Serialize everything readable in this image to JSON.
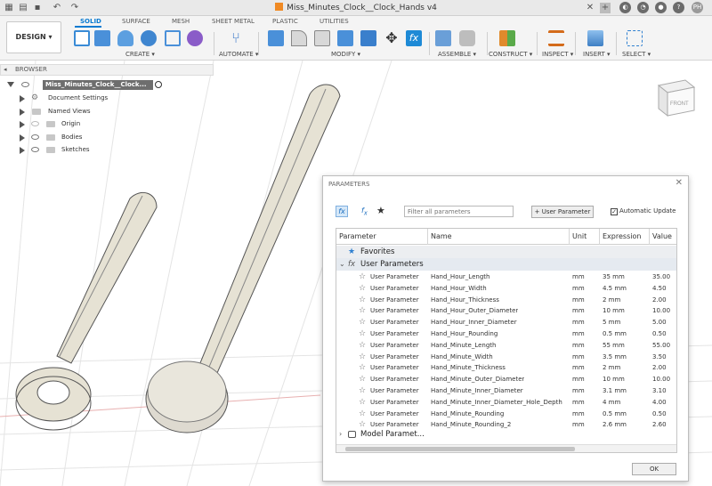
{
  "window": {
    "doc_title": "Miss_Minutes_Clock__Clock_Hands v4",
    "avatar": "PH"
  },
  "toolbar": {
    "design": "DESIGN ▾",
    "tabs": [
      "SOLID",
      "SURFACE",
      "MESH",
      "SHEET METAL",
      "PLASTIC",
      "UTILITIES"
    ],
    "groups": [
      "CREATE ▾",
      "AUTOMATE ▾",
      "MODIFY ▾",
      "ASSEMBLE ▾",
      "CONSTRUCT ▾",
      "INSPECT ▾",
      "INSERT ▾",
      "SELECT ▾"
    ]
  },
  "browser": {
    "header": "BROWSER",
    "items": [
      "Miss_Minutes_Clock__Clock...",
      "Document Settings",
      "Named Views",
      "Origin",
      "Bodies",
      "Sketches"
    ]
  },
  "viewcube": {
    "face": "FRONT"
  },
  "dialog": {
    "title": "PARAMETERS",
    "filter_placeholder": "Filter all parameters",
    "user_param_button": "+ User Parameter",
    "auto_update": "Automatic Update",
    "auto_update_checked": true,
    "columns": [
      "Parameter",
      "Name",
      "Unit",
      "Expression",
      "Value"
    ],
    "favorites": "Favorites",
    "user_params": "User Parameters",
    "model_params": "Model Paramet...",
    "ok": "OK",
    "rows": [
      {
        "param": "User Parameter",
        "name": "Hand_Hour_Length",
        "unit": "mm",
        "expr": "35 mm",
        "value": "35.00"
      },
      {
        "param": "User Parameter",
        "name": "Hand_Hour_Width",
        "unit": "mm",
        "expr": "4.5 mm",
        "value": "4.50"
      },
      {
        "param": "User Parameter",
        "name": "Hand_Hour_Thickness",
        "unit": "mm",
        "expr": "2 mm",
        "value": "2.00"
      },
      {
        "param": "User Parameter",
        "name": "Hand_Hour_Outer_Diameter",
        "unit": "mm",
        "expr": "10 mm",
        "value": "10.00"
      },
      {
        "param": "User Parameter",
        "name": "Hand_Hour_Inner_Diameter",
        "unit": "mm",
        "expr": "5 mm",
        "value": "5.00"
      },
      {
        "param": "User Parameter",
        "name": "Hand_Hour_Rounding",
        "unit": "mm",
        "expr": "0.5 mm",
        "value": "0.50"
      },
      {
        "param": "User Parameter",
        "name": "Hand_Minute_Length",
        "unit": "mm",
        "expr": "55 mm",
        "value": "55.00"
      },
      {
        "param": "User Parameter",
        "name": "Hand_Minute_Width",
        "unit": "mm",
        "expr": "3.5 mm",
        "value": "3.50"
      },
      {
        "param": "User Parameter",
        "name": "Hand_Minute_Thickness",
        "unit": "mm",
        "expr": "2 mm",
        "value": "2.00"
      },
      {
        "param": "User Parameter",
        "name": "Hand_Minute_Outer_Diameter",
        "unit": "mm",
        "expr": "10 mm",
        "value": "10.00"
      },
      {
        "param": "User Parameter",
        "name": "Hand_Minute_Inner_Diameter",
        "unit": "mm",
        "expr": "3.1 mm",
        "value": "3.10"
      },
      {
        "param": "User Parameter",
        "name": "Hand_Minute_Inner_Diameter_Hole_Depth",
        "unit": "mm",
        "expr": "4 mm",
        "value": "4.00"
      },
      {
        "param": "User Parameter",
        "name": "Hand_Minute_Rounding",
        "unit": "mm",
        "expr": "0.5 mm",
        "value": "0.50"
      },
      {
        "param": "User Parameter",
        "name": "Hand_Minute_Rounding_2",
        "unit": "mm",
        "expr": "2.6 mm",
        "value": "2.60"
      }
    ]
  },
  "colors": {
    "accent": "#0a7bd1",
    "model": "#e6e2d4",
    "model_edge": "#555555",
    "grid": "#e4e4e4"
  }
}
